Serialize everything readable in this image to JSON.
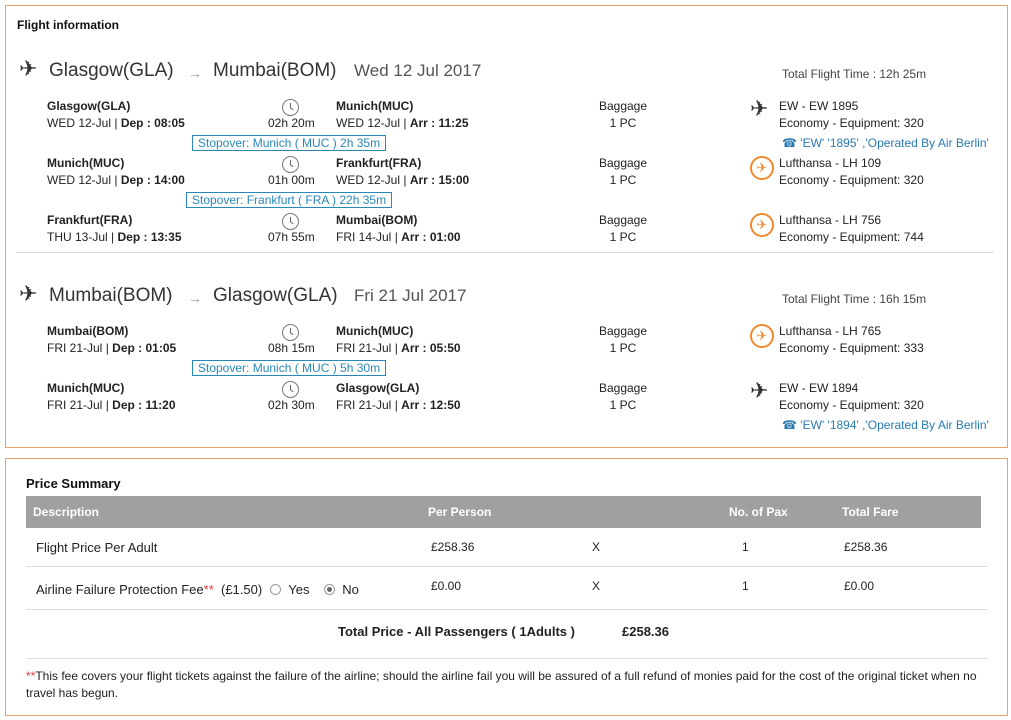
{
  "flight_info": {
    "title": "Flight information",
    "journeys": [
      {
        "direction_icon": "plane-departure-icon",
        "from": "Glasgow(GLA)",
        "arrow": "→",
        "to": "Mumbai(BOM)",
        "date": "Wed 12 Jul 2017",
        "total_time": "Total Flight Time : 12h 25m",
        "segments": [
          {
            "dep_city": "Glasgow(GLA)",
            "dep_day": "WED 12-Jul",
            "dep_label": "Dep :",
            "dep_time": "08:05",
            "duration": "02h 20m",
            "arr_city": "Munich(MUC)",
            "arr_day": "WED 12-Jul",
            "arr_label": "Arr :",
            "arr_time": "11:25",
            "baggage_label": "Baggage",
            "baggage_value": "1 PC",
            "carrier_icon": "plane-icon",
            "carrier": "EW - EW 1895",
            "equipment": "Economy - Equipment: 320",
            "operated_by": "'EW' '1895' ,'Operated By Air Berlin'"
          },
          {
            "dep_city": "Munich(MUC)",
            "dep_day": "WED 12-Jul",
            "dep_label": "Dep :",
            "dep_time": "14:00",
            "duration": "01h 00m",
            "arr_city": "Frankfurt(FRA)",
            "arr_day": "WED 12-Jul",
            "arr_label": "Arr :",
            "arr_time": "15:00",
            "baggage_label": "Baggage",
            "baggage_value": "1 PC",
            "carrier_icon": "lufthansa-crane-icon",
            "carrier": "Lufthansa - LH 109",
            "equipment": "Economy - Equipment: 320"
          },
          {
            "dep_city": "Frankfurt(FRA)",
            "dep_day": "THU 13-Jul",
            "dep_label": "Dep :",
            "dep_time": "13:35",
            "duration": "07h 55m",
            "arr_city": "Mumbai(BOM)",
            "arr_day": "FRI 14-Jul",
            "arr_label": "Arr :",
            "arr_time": "01:00",
            "baggage_label": "Baggage",
            "baggage_value": "1 PC",
            "carrier_icon": "lufthansa-crane-icon",
            "carrier": "Lufthansa - LH 756",
            "equipment": "Economy - Equipment: 744"
          }
        ],
        "stopovers": [
          "Stopover: Munich ( MUC ) 2h 35m",
          "Stopover: Frankfurt ( FRA ) 22h 35m"
        ]
      },
      {
        "direction_icon": "plane-arrival-icon",
        "from": "Mumbai(BOM)",
        "arrow": "→",
        "to": "Glasgow(GLA)",
        "date": "Fri 21 Jul 2017",
        "total_time": "Total Flight Time : 16h 15m",
        "segments": [
          {
            "dep_city": "Mumbai(BOM)",
            "dep_day": "FRI 21-Jul",
            "dep_label": "Dep :",
            "dep_time": "01:05",
            "duration": "08h 15m",
            "arr_city": "Munich(MUC)",
            "arr_day": "FRI 21-Jul",
            "arr_label": "Arr :",
            "arr_time": "05:50",
            "baggage_label": "Baggage",
            "baggage_value": "1 PC",
            "carrier_icon": "lufthansa-crane-icon",
            "carrier": "Lufthansa - LH 765",
            "equipment": "Economy - Equipment: 333"
          },
          {
            "dep_city": "Munich(MUC)",
            "dep_day": "FRI 21-Jul",
            "dep_label": "Dep :",
            "dep_time": "11:20",
            "duration": "02h 30m",
            "arr_city": "Glasgow(GLA)",
            "arr_day": "FRI 21-Jul",
            "arr_label": "Arr :",
            "arr_time": "12:50",
            "baggage_label": "Baggage",
            "baggage_value": "1 PC",
            "carrier_icon": "plane-icon",
            "carrier": "EW - EW 1894",
            "equipment": "Economy - Equipment: 320",
            "operated_by": "'EW' '1894' ,'Operated By Air Berlin'"
          }
        ],
        "stopovers": [
          "Stopover: Munich ( MUC ) 5h 30m"
        ]
      }
    ]
  },
  "price_summary": {
    "title": "Price Summary",
    "headers": [
      "Description",
      "Per Person",
      "No. of Pax",
      "Total Fare"
    ],
    "rows": [
      {
        "description": "Flight Price Per Adult",
        "per_person": "£258.36",
        "times": "X",
        "pax": "1",
        "total": "£258.36"
      },
      {
        "description": "Airline Failure Protection Fee",
        "asterisks": "**",
        "fee": "(£1.50)",
        "option_yes": "Yes",
        "option_no": "No",
        "selected": "No",
        "per_person": "£0.00",
        "times": "X",
        "pax": "1",
        "total": "£0.00"
      }
    ],
    "total_label": "Total Price - All Passengers ( 1Adults )",
    "total_value": "£258.36",
    "footnote_asterisks": "**",
    "footnote": "This fee covers your flight tickets against the failure of the airline; should the airline fail you will be assured of a full refund of monies paid for the cost of the original ticket when no travel has begun."
  },
  "colors": {
    "panel_border": "#e8a36a",
    "link_blue": "#2a7ab0",
    "stopover_blue": "#2a88b8",
    "header_gray": "#a0a0a0",
    "lufthansa_orange": "#f08a2c",
    "asterisk_red": "#e03a3a"
  }
}
